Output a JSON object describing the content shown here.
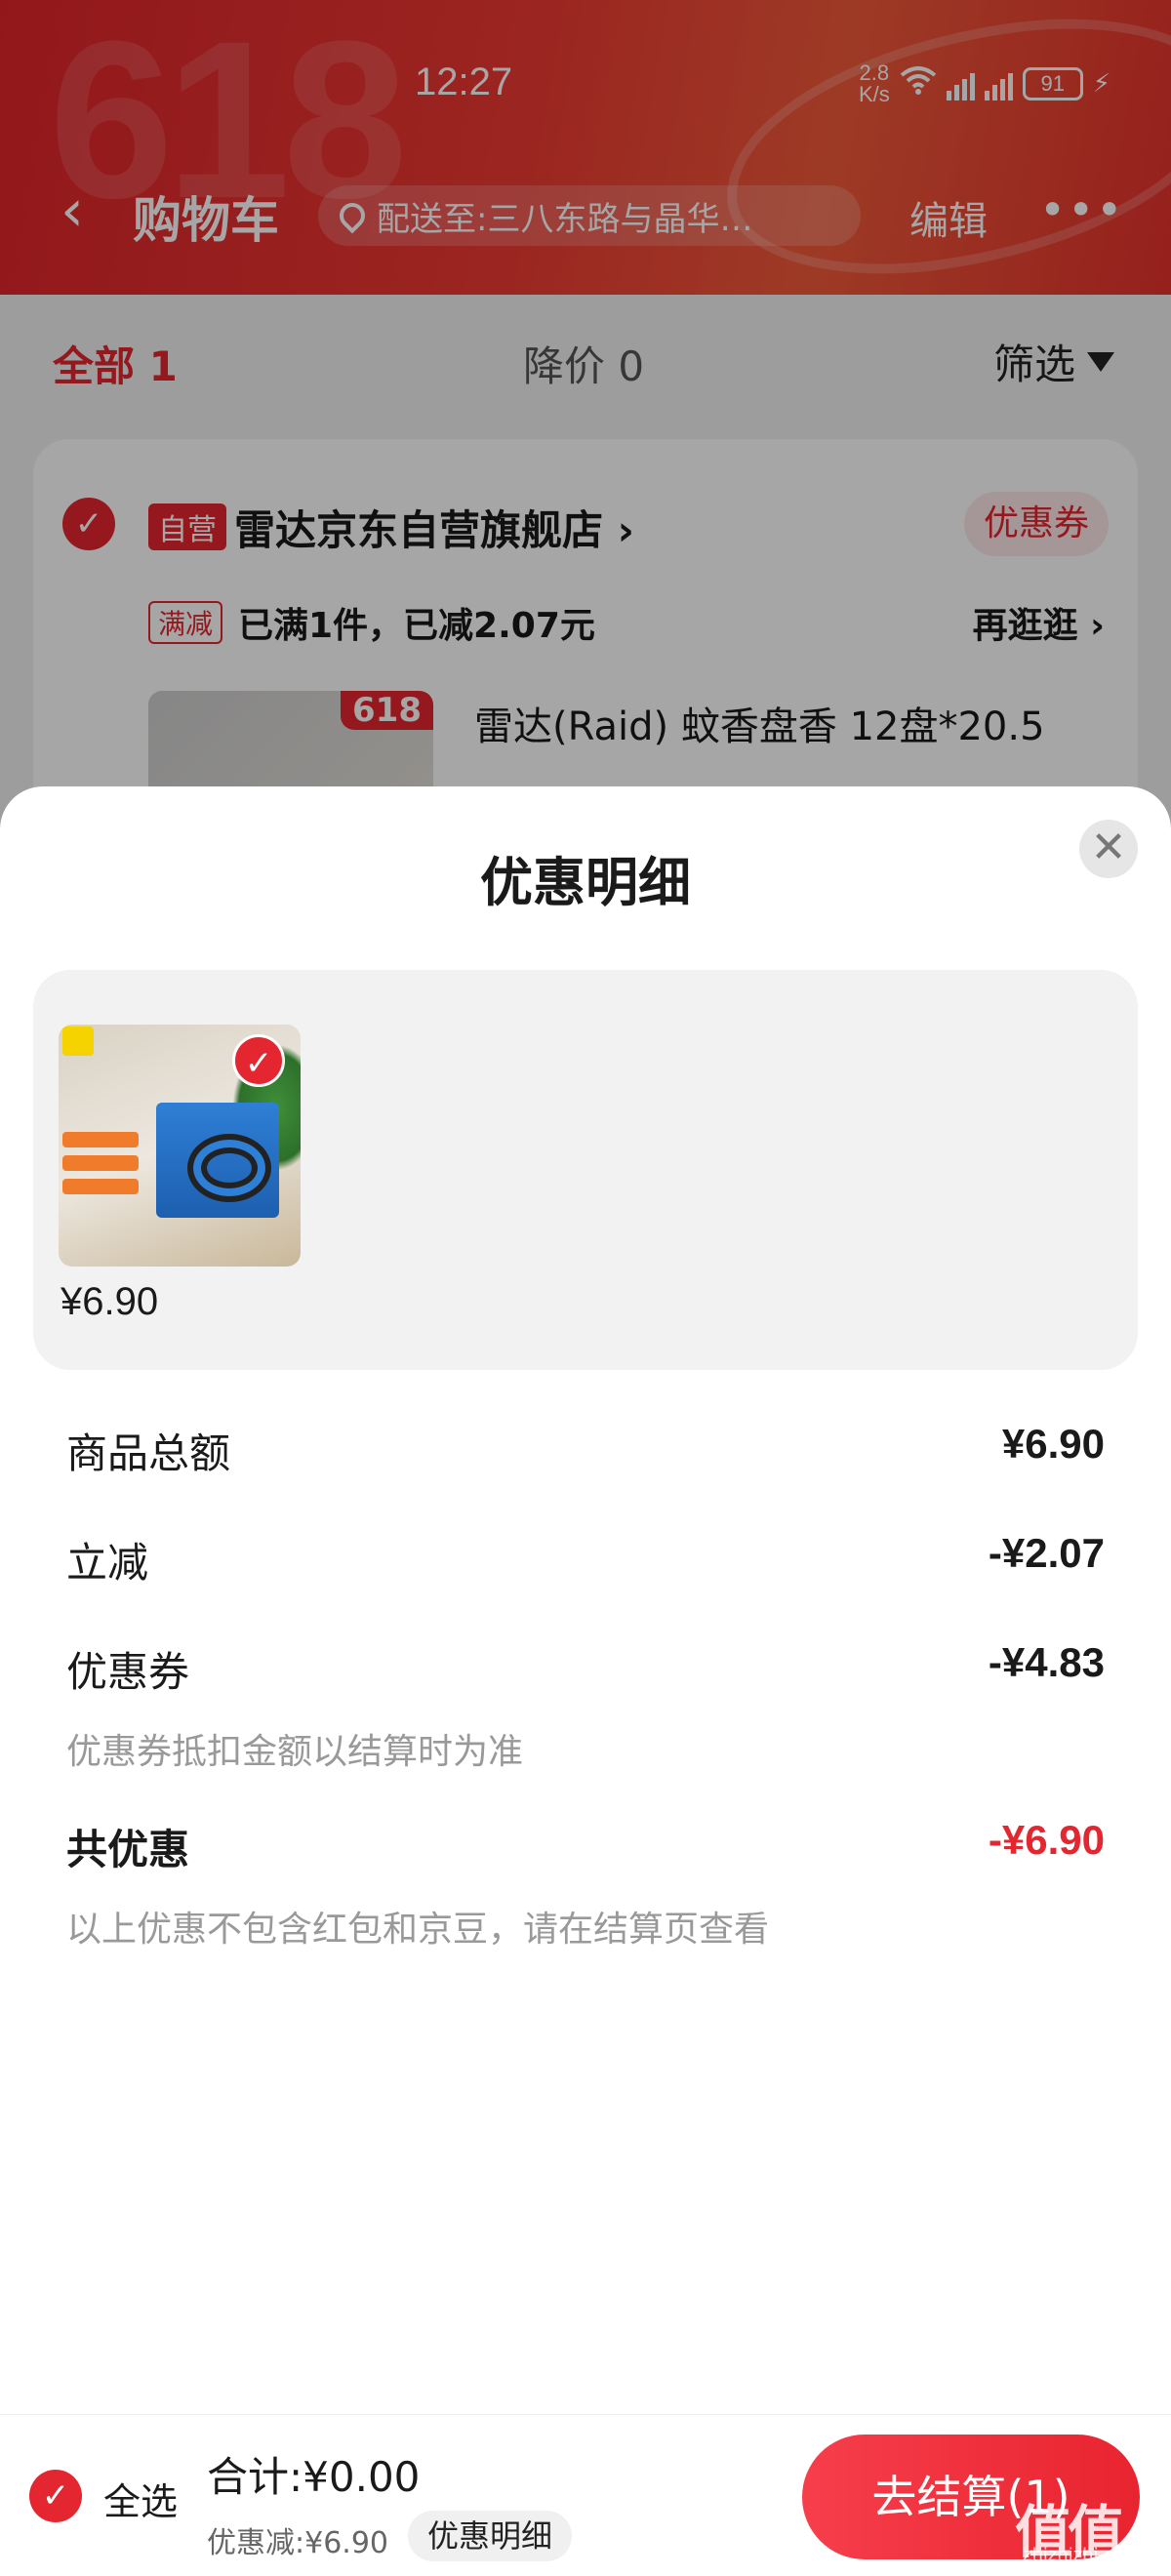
{
  "status_bar": {
    "time": "12:27",
    "net_speed": "2.8",
    "net_speed_unit": "K/s",
    "signal1_label": "4G",
    "signal2_label": "5G",
    "wifi_label": "6",
    "battery": "91"
  },
  "header": {
    "title": "购物车",
    "address": "配送至:三八东路与晶华…",
    "edit_label": "编辑",
    "more_label": "•••",
    "bg_watermark": "618"
  },
  "tabs": {
    "all_label": "全部 1",
    "price_drop_label": "降价 0",
    "filter_label": "筛选"
  },
  "store": {
    "self_tag": "自营",
    "name": "雷达京东自营旗舰店",
    "coupon_label": "优惠券",
    "promo_tag": "满减",
    "promo_text": "已满1件，已减2.07元",
    "stroll_label": "再逛逛",
    "product_badge": "618",
    "product_title": "雷达(Raid) 蚊香盘香 12盘*20.5"
  },
  "sheet": {
    "title": "优惠明细",
    "close_label": "✕",
    "item_price": "¥6.90",
    "rows": [
      {
        "label": "商品总额",
        "value": "¥6.90"
      },
      {
        "label": "立减",
        "value": "-¥2.07"
      },
      {
        "label": "优惠券",
        "value": "-¥4.83"
      }
    ],
    "coupon_note": "优惠券抵扣金额以结算时为准",
    "total_label": "共优惠",
    "total_value": "-¥6.90",
    "bottom_note": "以上优惠不包含红包和京豆，请在结算页查看"
  },
  "footer": {
    "select_all_label": "全选",
    "total_text": "合计:¥0.00",
    "discount_text": "优惠减:¥6.90",
    "detail_label": "优惠明细",
    "checkout_label": "去结算(1)"
  },
  "watermark": {
    "text": "值值值",
    "sub": "zhizhizhi.com"
  },
  "colors": {
    "accent": "#e3262f",
    "header_red": "#e0242a"
  }
}
